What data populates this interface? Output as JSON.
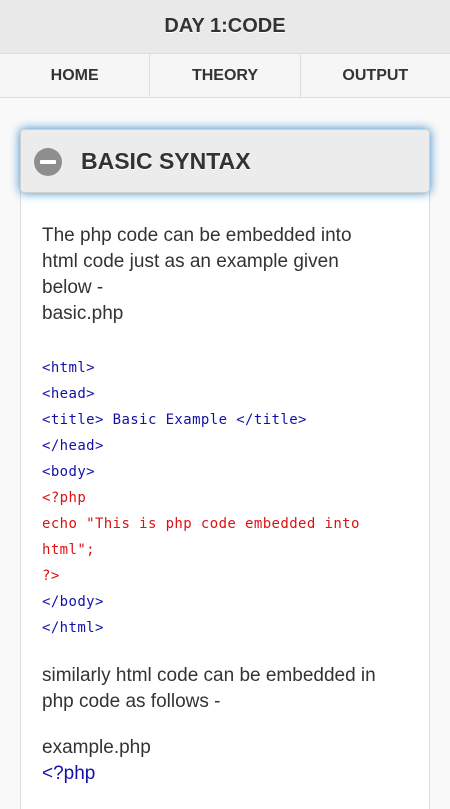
{
  "header": {
    "title": "DAY 1:CODE"
  },
  "navbar": {
    "tabs": [
      {
        "label": "HOME"
      },
      {
        "label": "THEORY"
      },
      {
        "label": "OUTPUT"
      }
    ]
  },
  "section": {
    "heading": "BASIC SYNTAX",
    "intro_lines": [
      "The php code can be embedded into",
      "html code just as an example given",
      "below -",
      "basic.php"
    ],
    "code_lines": [
      {
        "text": "<html>",
        "color": "blue"
      },
      {
        "text": "<head>",
        "color": "blue"
      },
      {
        "text": "<title> Basic Example </title>",
        "color": "blue"
      },
      {
        "text": "</head>",
        "color": "blue"
      },
      {
        "text": "<body>",
        "color": "blue"
      },
      {
        "text": "<?php",
        "color": "red"
      },
      {
        "text": "echo \"This is php code embedded into",
        "color": "red"
      },
      {
        "text": "html\";",
        "color": "red"
      },
      {
        "text": "?>",
        "color": "red"
      },
      {
        "text": "</body>",
        "color": "blue"
      },
      {
        "text": "</html>",
        "color": "blue"
      }
    ],
    "similar_lines": [
      "similarly html code can be embedded in",
      "php code as follows -"
    ],
    "example_file": "example.php",
    "example_code_start": "<?php"
  },
  "colors": {
    "code_blue": "#1111aa",
    "code_red": "#dd1111",
    "heading_glow": "#3388cc"
  }
}
